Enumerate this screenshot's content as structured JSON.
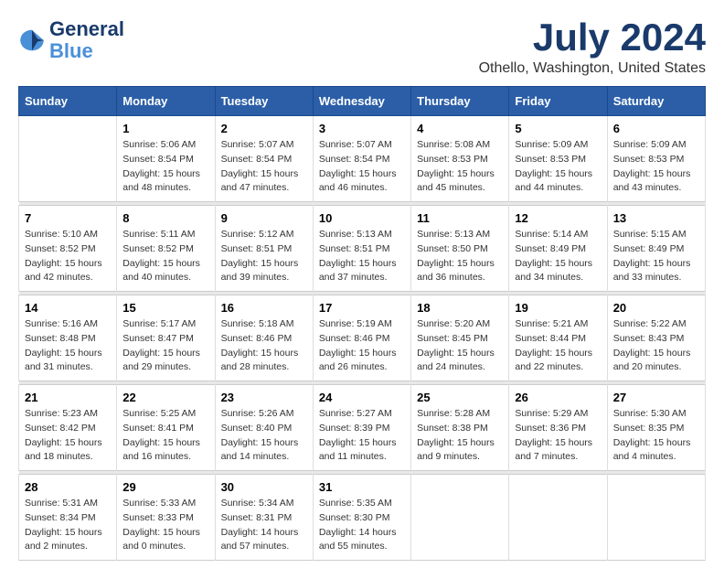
{
  "logo": {
    "text_general": "General",
    "text_blue": "Blue"
  },
  "title": "July 2024",
  "subtitle": "Othello, Washington, United States",
  "days_of_week": [
    "Sunday",
    "Monday",
    "Tuesday",
    "Wednesday",
    "Thursday",
    "Friday",
    "Saturday"
  ],
  "weeks": [
    [
      {
        "day": "",
        "info": ""
      },
      {
        "day": "1",
        "info": "Sunrise: 5:06 AM\nSunset: 8:54 PM\nDaylight: 15 hours\nand 48 minutes."
      },
      {
        "day": "2",
        "info": "Sunrise: 5:07 AM\nSunset: 8:54 PM\nDaylight: 15 hours\nand 47 minutes."
      },
      {
        "day": "3",
        "info": "Sunrise: 5:07 AM\nSunset: 8:54 PM\nDaylight: 15 hours\nand 46 minutes."
      },
      {
        "day": "4",
        "info": "Sunrise: 5:08 AM\nSunset: 8:53 PM\nDaylight: 15 hours\nand 45 minutes."
      },
      {
        "day": "5",
        "info": "Sunrise: 5:09 AM\nSunset: 8:53 PM\nDaylight: 15 hours\nand 44 minutes."
      },
      {
        "day": "6",
        "info": "Sunrise: 5:09 AM\nSunset: 8:53 PM\nDaylight: 15 hours\nand 43 minutes."
      }
    ],
    [
      {
        "day": "7",
        "info": "Sunrise: 5:10 AM\nSunset: 8:52 PM\nDaylight: 15 hours\nand 42 minutes."
      },
      {
        "day": "8",
        "info": "Sunrise: 5:11 AM\nSunset: 8:52 PM\nDaylight: 15 hours\nand 40 minutes."
      },
      {
        "day": "9",
        "info": "Sunrise: 5:12 AM\nSunset: 8:51 PM\nDaylight: 15 hours\nand 39 minutes."
      },
      {
        "day": "10",
        "info": "Sunrise: 5:13 AM\nSunset: 8:51 PM\nDaylight: 15 hours\nand 37 minutes."
      },
      {
        "day": "11",
        "info": "Sunrise: 5:13 AM\nSunset: 8:50 PM\nDaylight: 15 hours\nand 36 minutes."
      },
      {
        "day": "12",
        "info": "Sunrise: 5:14 AM\nSunset: 8:49 PM\nDaylight: 15 hours\nand 34 minutes."
      },
      {
        "day": "13",
        "info": "Sunrise: 5:15 AM\nSunset: 8:49 PM\nDaylight: 15 hours\nand 33 minutes."
      }
    ],
    [
      {
        "day": "14",
        "info": "Sunrise: 5:16 AM\nSunset: 8:48 PM\nDaylight: 15 hours\nand 31 minutes."
      },
      {
        "day": "15",
        "info": "Sunrise: 5:17 AM\nSunset: 8:47 PM\nDaylight: 15 hours\nand 29 minutes."
      },
      {
        "day": "16",
        "info": "Sunrise: 5:18 AM\nSunset: 8:46 PM\nDaylight: 15 hours\nand 28 minutes."
      },
      {
        "day": "17",
        "info": "Sunrise: 5:19 AM\nSunset: 8:46 PM\nDaylight: 15 hours\nand 26 minutes."
      },
      {
        "day": "18",
        "info": "Sunrise: 5:20 AM\nSunset: 8:45 PM\nDaylight: 15 hours\nand 24 minutes."
      },
      {
        "day": "19",
        "info": "Sunrise: 5:21 AM\nSunset: 8:44 PM\nDaylight: 15 hours\nand 22 minutes."
      },
      {
        "day": "20",
        "info": "Sunrise: 5:22 AM\nSunset: 8:43 PM\nDaylight: 15 hours\nand 20 minutes."
      }
    ],
    [
      {
        "day": "21",
        "info": "Sunrise: 5:23 AM\nSunset: 8:42 PM\nDaylight: 15 hours\nand 18 minutes."
      },
      {
        "day": "22",
        "info": "Sunrise: 5:25 AM\nSunset: 8:41 PM\nDaylight: 15 hours\nand 16 minutes."
      },
      {
        "day": "23",
        "info": "Sunrise: 5:26 AM\nSunset: 8:40 PM\nDaylight: 15 hours\nand 14 minutes."
      },
      {
        "day": "24",
        "info": "Sunrise: 5:27 AM\nSunset: 8:39 PM\nDaylight: 15 hours\nand 11 minutes."
      },
      {
        "day": "25",
        "info": "Sunrise: 5:28 AM\nSunset: 8:38 PM\nDaylight: 15 hours\nand 9 minutes."
      },
      {
        "day": "26",
        "info": "Sunrise: 5:29 AM\nSunset: 8:36 PM\nDaylight: 15 hours\nand 7 minutes."
      },
      {
        "day": "27",
        "info": "Sunrise: 5:30 AM\nSunset: 8:35 PM\nDaylight: 15 hours\nand 4 minutes."
      }
    ],
    [
      {
        "day": "28",
        "info": "Sunrise: 5:31 AM\nSunset: 8:34 PM\nDaylight: 15 hours\nand 2 minutes."
      },
      {
        "day": "29",
        "info": "Sunrise: 5:33 AM\nSunset: 8:33 PM\nDaylight: 15 hours\nand 0 minutes."
      },
      {
        "day": "30",
        "info": "Sunrise: 5:34 AM\nSunset: 8:31 PM\nDaylight: 14 hours\nand 57 minutes."
      },
      {
        "day": "31",
        "info": "Sunrise: 5:35 AM\nSunset: 8:30 PM\nDaylight: 14 hours\nand 55 minutes."
      },
      {
        "day": "",
        "info": ""
      },
      {
        "day": "",
        "info": ""
      },
      {
        "day": "",
        "info": ""
      }
    ]
  ]
}
